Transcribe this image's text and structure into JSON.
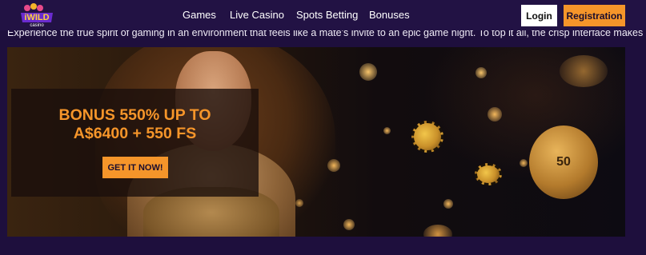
{
  "header": {
    "logo": {
      "text": "iWILD",
      "subtext": "casino"
    },
    "nav": [
      {
        "label": "Games"
      },
      {
        "label": "Live Casino"
      },
      {
        "label": "Spots Betting"
      },
      {
        "label": "Bonuses"
      }
    ],
    "login_label": "Login",
    "register_label": "Registration"
  },
  "intro": {
    "text": "Experience the true spirit of gaming in an environment that feels like a mate's invite to an epic game night. To top it all, the crisp interface makes navigation a breeze."
  },
  "banner": {
    "promo_line1": "BONUS 550% UP TO",
    "promo_line2": "A$6400 + 550 FS",
    "cta_label": "GET IT NOW!",
    "coin_label": "50"
  },
  "colors": {
    "accent": "#f5952a",
    "header_bg": "#221244",
    "page_bg": "#1e0f3d"
  }
}
